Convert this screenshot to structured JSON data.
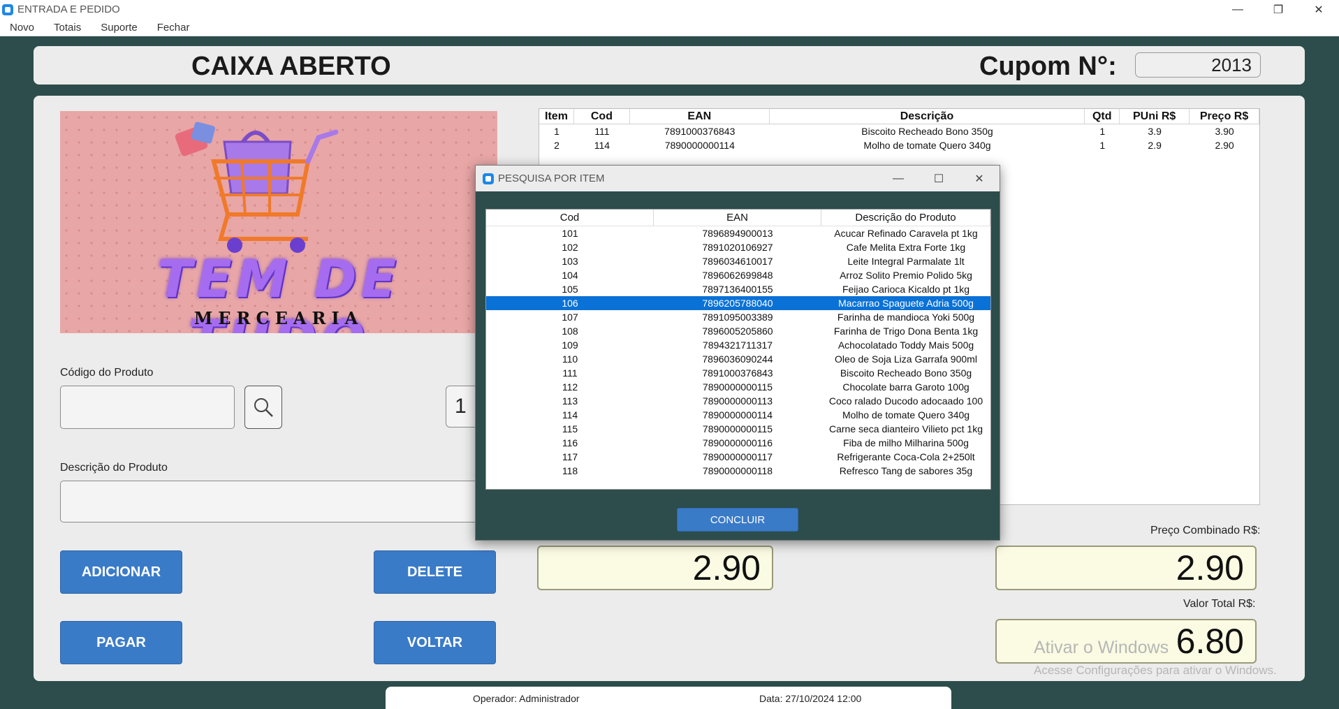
{
  "window": {
    "title": "ENTRADA E PEDIDO",
    "controls": [
      "—",
      "❐",
      "✕"
    ]
  },
  "menu": [
    "Novo",
    "Totais",
    "Suporte",
    "Fechar"
  ],
  "header": {
    "caixa_status": "CAIXA ABERTO",
    "cupom_label": "Cupom N°:",
    "cupom_value": "2013"
  },
  "logo": {
    "title": "TEM DE TUDO",
    "subtitle": "MERCEARIA"
  },
  "form": {
    "codigo_label": "Código do Produto",
    "codigo_value": "",
    "quantidade_value": "1",
    "descricao_label": "Descrição do Produto",
    "descricao_value": ""
  },
  "buttons": {
    "adicionar": "ADICIONAR",
    "delete": "DELETE",
    "pagar": "PAGAR",
    "voltar": "VOLTAR"
  },
  "items_table": {
    "columns": [
      "Item",
      "Cod",
      "EAN",
      "Descrição",
      "Qtd",
      "PUni R$",
      "Preço R$"
    ],
    "rows": [
      [
        "1",
        "111",
        "7891000376843",
        "Biscoito Recheado Bono 350g",
        "1",
        "3.9",
        "3.90"
      ],
      [
        "2",
        "114",
        "7890000000114",
        "Molho de tomate Quero 340g",
        "1",
        "2.9",
        "2.90"
      ]
    ]
  },
  "prices": {
    "unit_price": "2.90",
    "preco_combinado_label": "Preço Combinado R$:",
    "preco_combinado_value": "2.90",
    "valor_total_label": "Valor Total R$:",
    "valor_total_value": "6.80"
  },
  "watermark": {
    "line1": "Ativar o Windows",
    "line2": "Acesse Configurações para ativar o Windows."
  },
  "status_bar": {
    "operador": "Operador: Administrador",
    "data": "Data: 27/10/2024 12:00"
  },
  "search_dialog": {
    "title": "PESQUISA POR ITEM",
    "controls": [
      "—",
      "☐",
      "✕"
    ],
    "columns": [
      "Cod",
      "EAN",
      "Descrição do Produto"
    ],
    "selected_index": 5,
    "rows": [
      [
        "101",
        "7896894900013",
        "Acucar Refinado Caravela pt 1kg"
      ],
      [
        "102",
        "7891020106927",
        "Cafe Melita Extra Forte 1kg"
      ],
      [
        "103",
        "7896034610017",
        "Leite Integral Parmalate 1lt"
      ],
      [
        "104",
        "7896062699848",
        "Arroz Solito Premio Polido 5kg"
      ],
      [
        "105",
        "7897136400155",
        "Feijao Carioca Kicaldo pt 1kg"
      ],
      [
        "106",
        "7896205788040",
        "Macarrao Spaguete Adria 500g"
      ],
      [
        "107",
        "7891095003389",
        "Farinha de mandioca Yoki 500g"
      ],
      [
        "108",
        "7896005205860",
        "Farinha de Trigo Dona Benta 1kg"
      ],
      [
        "109",
        "7894321711317",
        "Achocolatado Toddy Mais 500g"
      ],
      [
        "110",
        "7896036090244",
        "Oleo de Soja Liza Garrafa 900ml"
      ],
      [
        "111",
        "7891000376843",
        "Biscoito Recheado Bono 350g"
      ],
      [
        "112",
        "7890000000115",
        "Chocolate barra Garoto 100g"
      ],
      [
        "113",
        "7890000000113",
        "Coco ralado Ducodo adocaado 100"
      ],
      [
        "114",
        "7890000000114",
        "Molho de tomate Quero 340g"
      ],
      [
        "115",
        "7890000000115",
        "Carne seca dianteiro Vilieto pct 1kg"
      ],
      [
        "116",
        "7890000000116",
        "Fiba de milho Milharina 500g"
      ],
      [
        "117",
        "7890000000117",
        "Refrigerante Coca-Cola 2+250lt"
      ],
      [
        "118",
        "7890000000118",
        "Refresco Tang de sabores 35g"
      ]
    ],
    "concluir": "CONCLUIR"
  }
}
